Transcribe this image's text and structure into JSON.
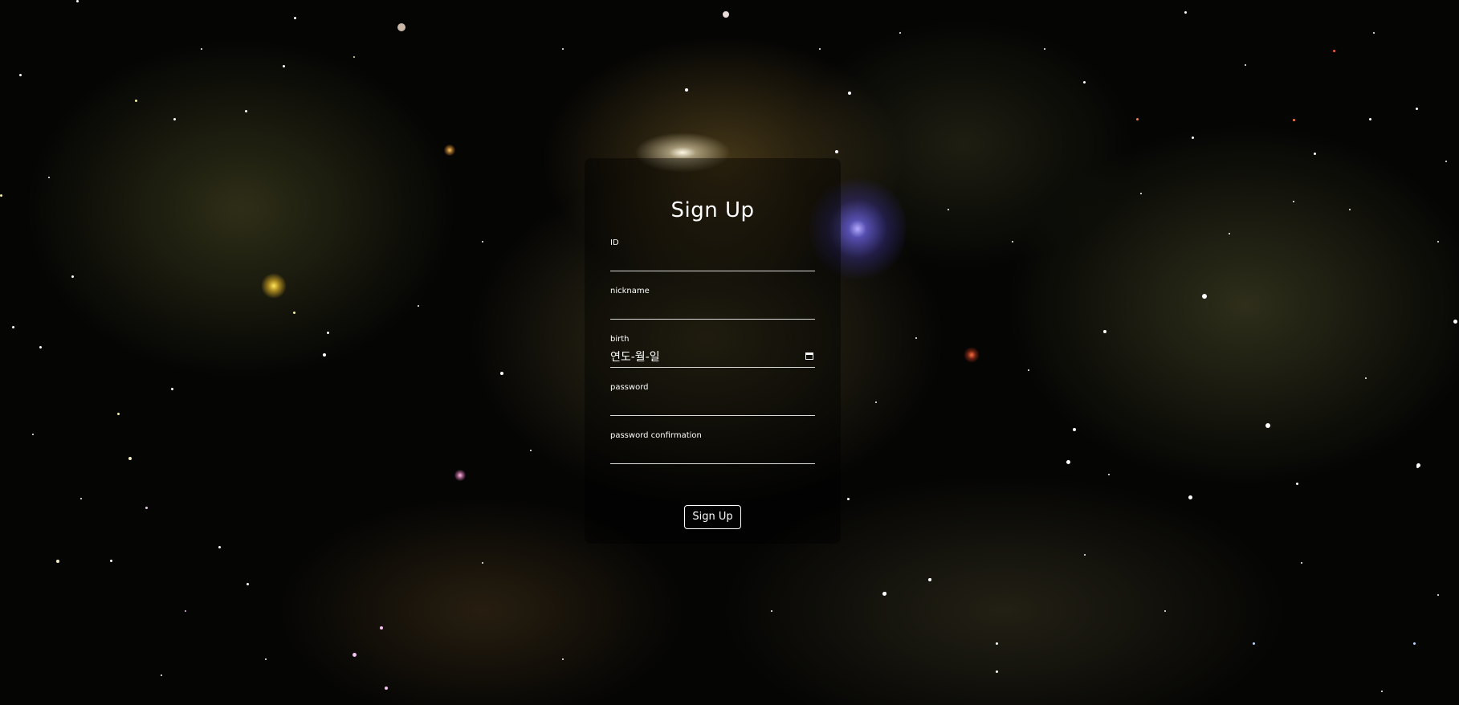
{
  "page": {
    "background_color": "#050504",
    "accent": "#ffffff"
  },
  "form": {
    "title": "Sign Up",
    "fields": [
      {
        "label": "ID",
        "value": ""
      },
      {
        "label": "nickname",
        "value": ""
      },
      {
        "label": "birth",
        "value": "연도-월-일",
        "icon": "calendar-icon"
      },
      {
        "label": "password",
        "value": ""
      },
      {
        "label": "password confirmation",
        "value": ""
      }
    ],
    "submit_label": "Sign Up"
  }
}
